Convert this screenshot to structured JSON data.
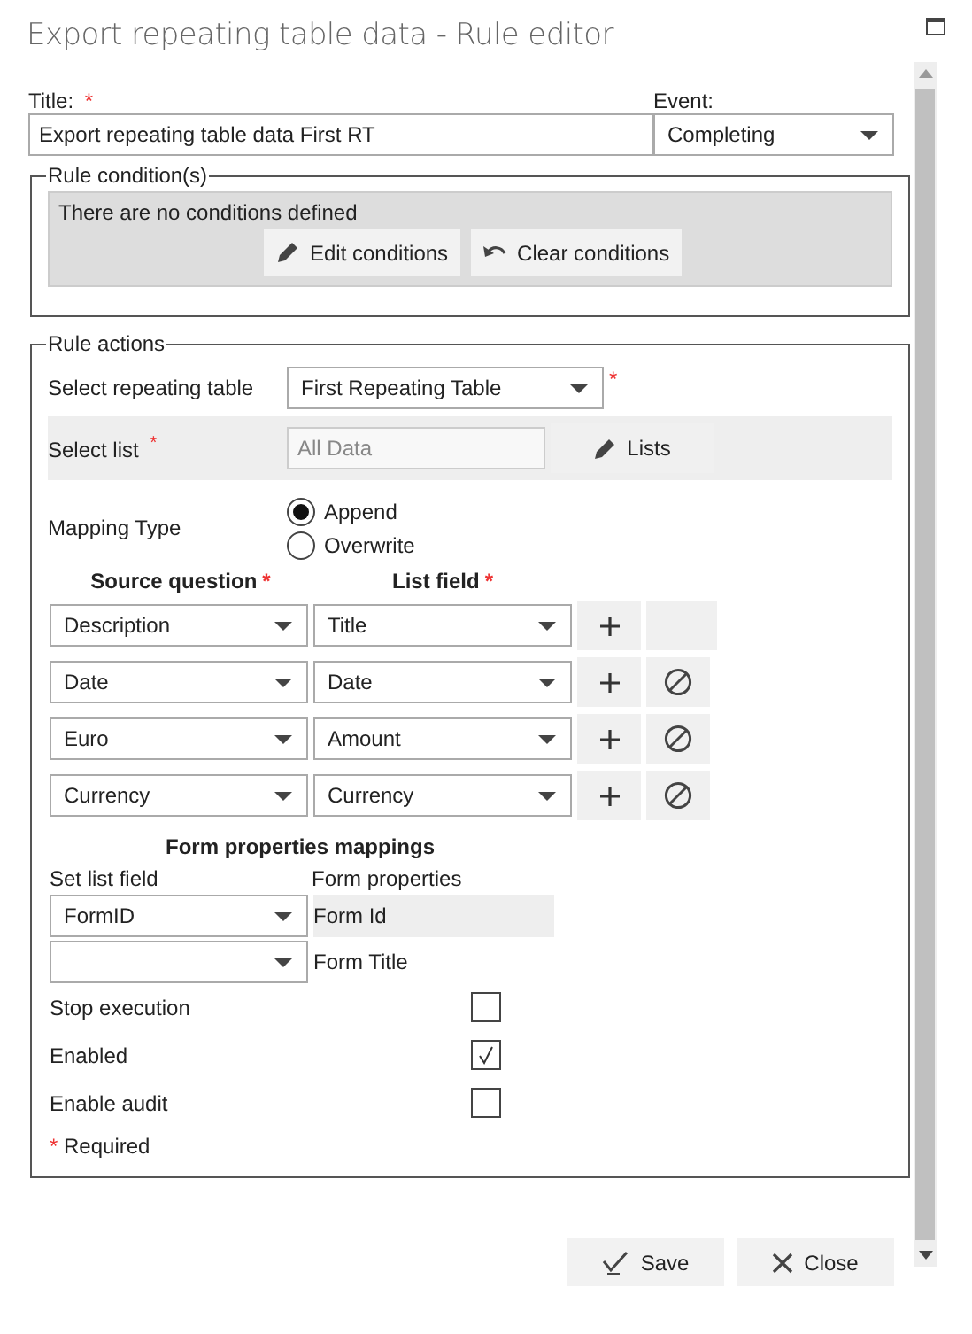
{
  "window": {
    "title": "Export repeating table data - Rule editor"
  },
  "title_field": {
    "label": "Title:",
    "required_mark": "*",
    "value": "Export repeating table data First RT"
  },
  "event_field": {
    "label": "Event:",
    "value": "Completing"
  },
  "rule_conditions": {
    "legend": "Rule condition(s)",
    "message": "There are no conditions defined",
    "buttons": [
      {
        "label": "Edit conditions",
        "kind": "edit"
      },
      {
        "label": "Clear conditions",
        "kind": "undo"
      }
    ]
  },
  "rule_actions": {
    "legend": "Rule actions",
    "repeating_table": {
      "label": "Select repeating table",
      "value": "First Repeating Table",
      "required_mark": "*"
    },
    "list": {
      "label": "Select list",
      "required_mark": "*",
      "value": "All Data",
      "button": "Lists"
    },
    "mapping_type": {
      "label": "Mapping Type",
      "options": [
        {
          "label": "Append",
          "selected": true
        },
        {
          "label": "Overwrite",
          "selected": false
        }
      ]
    },
    "mappings": {
      "columns": [
        {
          "label": "Source question",
          "required_mark": "*"
        },
        {
          "label": "List field",
          "required_mark": "*"
        }
      ],
      "rows": [
        {
          "source": "Description",
          "field": "Title",
          "removable": false
        },
        {
          "source": "Date",
          "field": "Date",
          "removable": true
        },
        {
          "source": "Euro",
          "field": "Amount",
          "removable": true
        },
        {
          "source": "Currency",
          "field": "Currency",
          "removable": true
        }
      ]
    },
    "form_properties": {
      "heading": "Form properties mappings",
      "columns": [
        "Set list field",
        "Form properties"
      ],
      "rows": [
        {
          "list_field": "FormID",
          "property": "Form Id",
          "selected": true
        },
        {
          "property": "Form Title",
          "selected": false
        }
      ]
    },
    "options": [
      {
        "label": "Stop execution",
        "checked": false
      },
      {
        "label": "Enabled",
        "checked": true
      },
      {
        "label": "Enable audit",
        "checked": false
      }
    ],
    "required_note": {
      "mark": "*",
      "text": "Required"
    }
  },
  "buttons": [
    {
      "label": "Save",
      "kind": "save"
    },
    {
      "label": "Close",
      "kind": "close"
    }
  ]
}
